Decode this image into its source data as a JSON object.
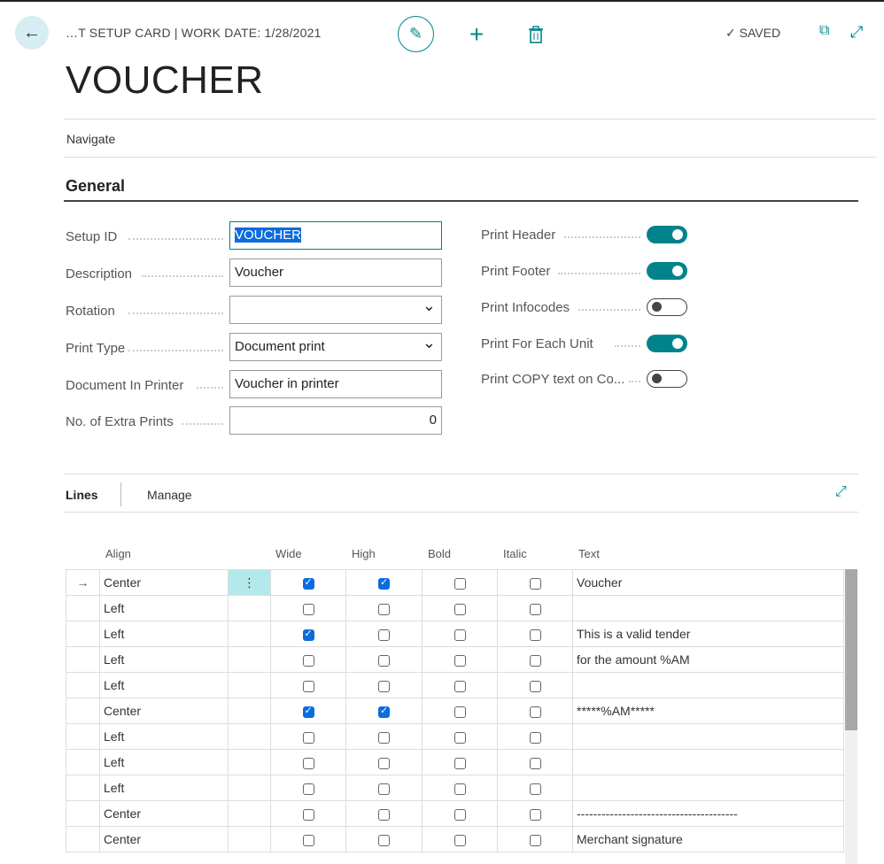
{
  "header": {
    "breadcrumb": "…T SETUP CARD | WORK DATE: 1/28/2021",
    "saved": "SAVED",
    "title": "VOUCHER"
  },
  "nav": {
    "navigate": "Navigate"
  },
  "general": {
    "title": "General",
    "fields": [
      {
        "label": "Setup ID",
        "value": "VOUCHER"
      },
      {
        "label": "Description",
        "value": "Voucher"
      },
      {
        "label": "Rotation",
        "value": ""
      },
      {
        "label": "Print Type",
        "value": "Document print"
      },
      {
        "label": "Document In Printer",
        "value": "Voucher in printer"
      },
      {
        "label": "No. of Extra Prints",
        "value": "0"
      }
    ],
    "toggles": [
      {
        "label": "Print Header",
        "on": true
      },
      {
        "label": "Print Footer",
        "on": true
      },
      {
        "label": "Print Infocodes",
        "on": false
      },
      {
        "label": "Print For Each Unit",
        "on": true
      },
      {
        "label": "Print COPY text on Co...",
        "on": false
      }
    ]
  },
  "lines": {
    "tab": "Lines",
    "manage": "Manage",
    "columns": [
      "Align",
      "Wide",
      "High",
      "Bold",
      "Italic",
      "Text"
    ],
    "rows": [
      {
        "align": "Center",
        "wide": true,
        "high": true,
        "bold": false,
        "italic": false,
        "text": "Voucher"
      },
      {
        "align": "Left",
        "wide": false,
        "high": false,
        "bold": false,
        "italic": false,
        "text": ""
      },
      {
        "align": "Left",
        "wide": true,
        "high": false,
        "bold": false,
        "italic": false,
        "text": "This is a valid tender"
      },
      {
        "align": "Left",
        "wide": false,
        "high": false,
        "bold": false,
        "italic": false,
        "text": "for the amount %AM"
      },
      {
        "align": "Left",
        "wide": false,
        "high": false,
        "bold": false,
        "italic": false,
        "text": ""
      },
      {
        "align": "Center",
        "wide": true,
        "high": true,
        "bold": false,
        "italic": false,
        "text": "*****%AM*****"
      },
      {
        "align": "Left",
        "wide": false,
        "high": false,
        "bold": false,
        "italic": false,
        "text": ""
      },
      {
        "align": "Left",
        "wide": false,
        "high": false,
        "bold": false,
        "italic": false,
        "text": ""
      },
      {
        "align": "Left",
        "wide": false,
        "high": false,
        "bold": false,
        "italic": false,
        "text": ""
      },
      {
        "align": "Center",
        "wide": false,
        "high": false,
        "bold": false,
        "italic": false,
        "text": "---------------------------------------"
      },
      {
        "align": "Center",
        "wide": false,
        "high": false,
        "bold": false,
        "italic": false,
        "text": "Merchant signature"
      }
    ]
  }
}
